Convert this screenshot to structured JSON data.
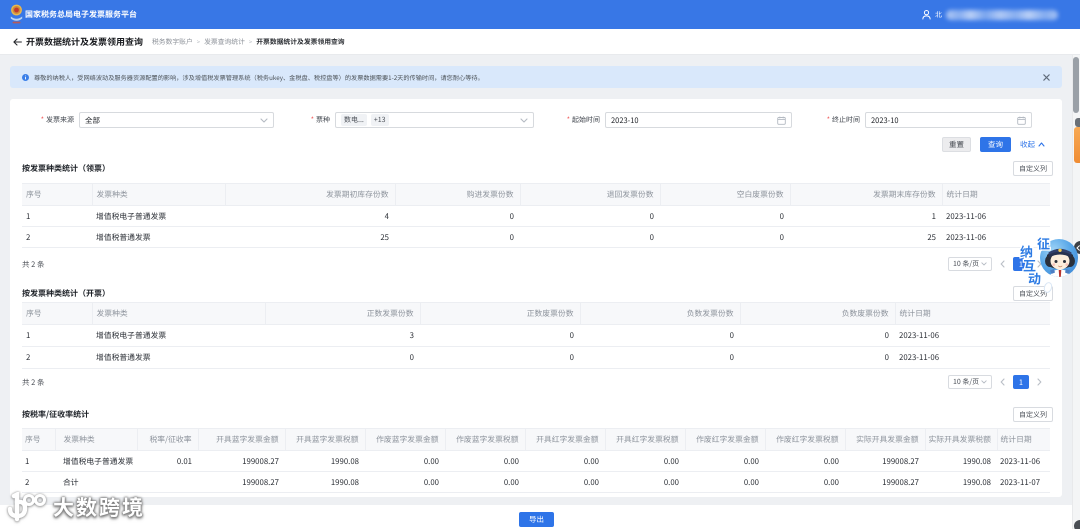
{
  "topbar": {
    "brand": "国家税务总局电子发票服务平台",
    "user_prefix": "北"
  },
  "titlebar": {
    "title": "开票数据统计及发票领用查询",
    "breadcrumbs": [
      "税务数字账户",
      "发票查询统计",
      "开票数据统计及发票领用查询"
    ]
  },
  "banner": {
    "text": "尊敬的纳税人，受网络波动及服务器资源配置的影响，涉及增值税发票管理系统（税务ukey、金税盘、税控盘等）的发票数据需要1-2天的传输时间，请您耐心等待。"
  },
  "filters": {
    "source": {
      "label": "发票来源",
      "value": "全部"
    },
    "type": {
      "label": "票种",
      "tags": [
        "数电...",
        "+13"
      ]
    },
    "start": {
      "label": "起始时间",
      "value": "2023-10"
    },
    "end": {
      "label": "终止时间",
      "value": "2023-10"
    }
  },
  "actions": {
    "reset": "重置",
    "query": "查询",
    "collapse": "收起"
  },
  "customize_label": "自定义列",
  "sections": [
    {
      "title": "按发票种类统计（领票）",
      "columns": [
        "序号",
        "发票种类",
        "发票期初库存份数",
        "购进发票份数",
        "退回发票份数",
        "空白废票份数",
        "发票期末库存份数",
        "统计日期"
      ],
      "rows": [
        [
          "1",
          "增值税电子普通发票",
          "4",
          "0",
          "0",
          "0",
          "1",
          "2023-11-06"
        ],
        [
          "2",
          "增值税普通发票",
          "25",
          "0",
          "0",
          "0",
          "25",
          "2023-11-06"
        ]
      ],
      "total": "共 2 条",
      "page_size": "10 条/页",
      "page": "1"
    },
    {
      "title": "按发票种类统计（开票）",
      "columns": [
        "序号",
        "发票种类",
        "正数发票份数",
        "正数废票份数",
        "负数发票份数",
        "负数废票份数",
        "统计日期"
      ],
      "rows": [
        [
          "1",
          "增值税电子普通发票",
          "3",
          "0",
          "0",
          "0",
          "2023-11-06"
        ],
        [
          "2",
          "增值税普通发票",
          "0",
          "0",
          "0",
          "0",
          "2023-11-06"
        ]
      ],
      "total": "共 2 条",
      "page_size": "10 条/页",
      "page": "1"
    },
    {
      "title": "按税率/征收率统计",
      "columns": [
        "序号",
        "发票种类",
        "税率/征收率",
        "开具蓝字发票金额",
        "开具蓝字发票税额",
        "作废蓝字发票金额",
        "作废蓝字发票税额",
        "开具红字发票金额",
        "开具红字发票税额",
        "作废红字发票金额",
        "作废红字发票税额",
        "实际开具发票金额",
        "实际开具发票税额",
        "统计日期"
      ],
      "rows": [
        [
          "1",
          "增值税电子普通发票",
          "0.01",
          "199008.27",
          "1990.08",
          "0.00",
          "0.00",
          "0.00",
          "0.00",
          "0.00",
          "0.00",
          "199008.27",
          "1990.08",
          "2023-11-06"
        ],
        [
          "2",
          "合计",
          "",
          "199008.27",
          "1990.08",
          "0.00",
          "0.00",
          "0.00",
          "0.00",
          "0.00",
          "0.00",
          "199008.27",
          "1990.08",
          "2023-11-07"
        ]
      ]
    }
  ],
  "export_label": "导出",
  "mascot": {
    "chars": [
      "征",
      "纳",
      "互",
      "动"
    ]
  },
  "watermark": {
    "text": "大数跨境"
  },
  "colors": {
    "accent": "#2e74e8",
    "topbar": "#3877e6",
    "banner_bg": "#d9e8fb",
    "orange_tab": "#f59a3c"
  }
}
